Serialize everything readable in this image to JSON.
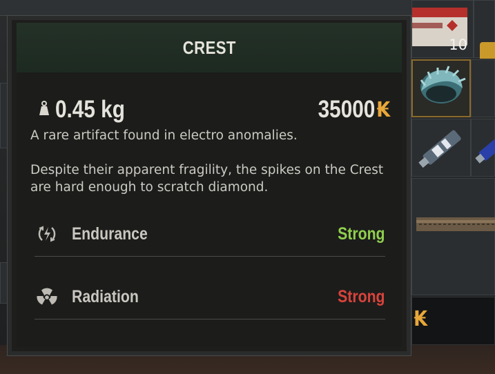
{
  "inventory": {
    "stack_count": "10",
    "currency_glyph": "₭"
  },
  "tooltip": {
    "title": "CREST",
    "weight": "0.45 kg",
    "weight_icon": "weight-icon",
    "price": "35000",
    "currency_glyph": "₭",
    "currency_color": "#e8a73a",
    "description": [
      "A rare artifact found in electro anomalies.",
      "Despite their apparent fragility, the spikes on the Crest are hard enough to scratch diamond."
    ],
    "stats": [
      {
        "name": "Endurance",
        "value": "Strong",
        "icon": "endurance-icon",
        "value_color": "#8fcf4e"
      },
      {
        "name": "Radiation",
        "value": "Strong",
        "icon": "radiation-icon",
        "value_color": "#d8433b"
      }
    ]
  }
}
